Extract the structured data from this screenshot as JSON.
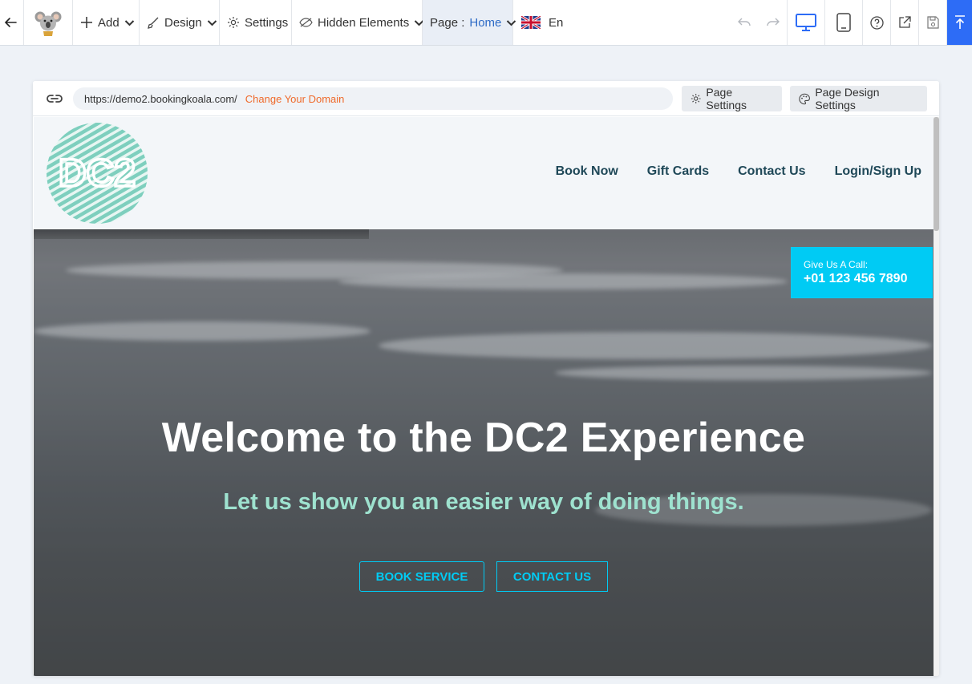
{
  "toolbar": {
    "add_label": "Add",
    "design_label": "Design",
    "settings_label": "Settings",
    "hidden_elements_label": "Hidden Elements",
    "page_label": "Page :",
    "page_value": "Home",
    "language_label": "En",
    "accent_color": "#2d6cf6"
  },
  "editor": {
    "url": "https://demo2.bookingkoala.com/",
    "change_domain_label": "Change Your Domain",
    "page_settings_label": "Page Settings",
    "page_design_settings_label": "Page Design Settings"
  },
  "site": {
    "logo_text": "DC2",
    "logo_color": "#7ecfbe",
    "nav": [
      "Book Now",
      "Gift Cards",
      "Contact Us",
      "Login/Sign Up"
    ],
    "call_label": "Give Us A Call:",
    "phone": "+01 123 456 7890",
    "hero_title": "Welcome to the DC2 Experience",
    "hero_subtitle": "Let us show you an easier way of doing things.",
    "book_service_label": "BOOK SERVICE",
    "contact_us_label": "CONTACT US",
    "cta_color": "#00cbf4"
  }
}
